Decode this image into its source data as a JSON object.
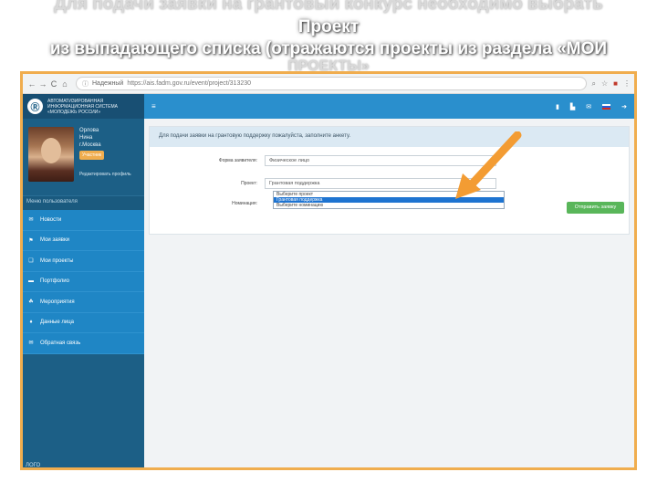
{
  "slide": {
    "ghost_top": "Для подачи заявки на грантовый конкурс необходимо выбрать",
    "title": "Проект",
    "subtitle": "из выпадающего списка (отражаются проекты из раздела «МОИ",
    "ghost_bottom": "ПРОЕКТЫ»"
  },
  "browser": {
    "back": "←",
    "forward": "→",
    "reload": "C",
    "home": "⌂",
    "not_secure": "Надежный",
    "url": "https://ais.fadm.gov.ru/event/project/313230",
    "icons": [
      "search-icon",
      "star-icon",
      "extension-icon",
      "menu-icon"
    ]
  },
  "sidebar": {
    "logo_emblem": "Ⓡ",
    "logo_text_1": "АВТОМАТИЗИРОВАННАЯ",
    "logo_text_2": "ИНФОРМАЦИОННАЯ СИСТЕМА",
    "logo_text_3": "«МОЛОДЕЖЬ РОССИИ»",
    "user": {
      "last_name": "Орлова",
      "first_name": "Нина",
      "city": "г.Москва",
      "status": "Участник",
      "edit_link": "Редактировать профиль"
    },
    "menu_title": "Меню пользователя",
    "menu": [
      {
        "icon": "megaphone-icon",
        "glyph": "✉",
        "label": "Новости"
      },
      {
        "icon": "flag-icon",
        "glyph": "⚑",
        "label": "Мои заявки"
      },
      {
        "icon": "document-icon",
        "glyph": "❑",
        "label": "Мои проекты"
      },
      {
        "icon": "folder-icon",
        "glyph": "▬",
        "label": "Портфолио"
      },
      {
        "icon": "events-icon",
        "glyph": "☘",
        "label": "Мероприятия"
      },
      {
        "icon": "pin-icon",
        "glyph": "♦",
        "label": "Данные лица"
      },
      {
        "icon": "mail-icon",
        "glyph": "✉",
        "label": "Обратная связь"
      }
    ],
    "footer": "ЛОГО"
  },
  "topbar": {
    "hamburger": "≡"
  },
  "form": {
    "header": "Для подачи заявки на грантовую поддержку пожалуйста, заполните анкету.",
    "fields": [
      {
        "label": "Форма заявителя:",
        "value": "Физическое лицо"
      },
      {
        "label": "Проект:",
        "value": "Грантовая поддержка"
      },
      {
        "label": "Номинация:",
        "value": ""
      }
    ],
    "dropdown_options": [
      "Выберите проект",
      "Грантовая поддержка",
      "Выберите номинацию"
    ],
    "selected_index": 1,
    "submit": "Отправить заявку"
  },
  "colors": {
    "sidebar": "#1c5f86",
    "menu": "#1f86c5",
    "topbar": "#2a8fcd",
    "accent_frame": "#f0ad4e",
    "submit": "#59b65a",
    "arrow": "#f39c33"
  }
}
